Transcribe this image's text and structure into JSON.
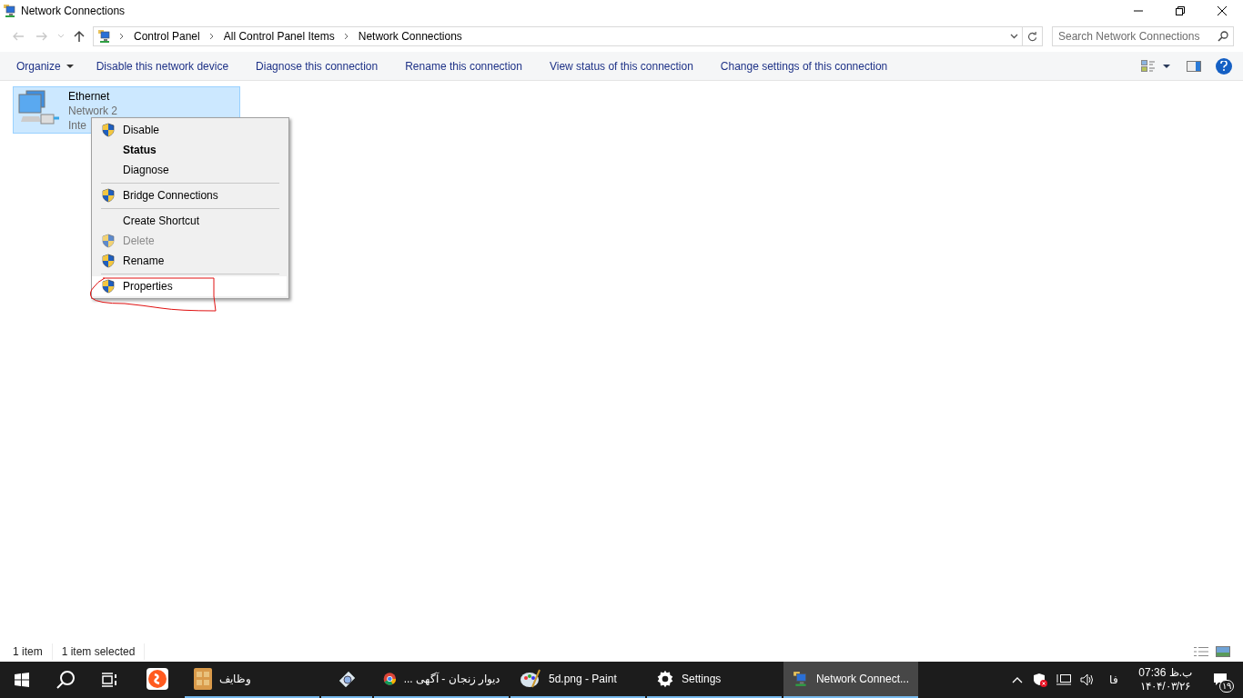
{
  "window": {
    "title": "Network Connections"
  },
  "address": {
    "breadcrumb": [
      "Control Panel",
      "All Control Panel Items",
      "Network Connections"
    ]
  },
  "search": {
    "placeholder": "Search Network Connections"
  },
  "toolbar": {
    "organize": "Organize",
    "commands": [
      "Disable this network device",
      "Diagnose this connection",
      "Rename this connection",
      "View status of this connection",
      "Change settings of this connection"
    ]
  },
  "items": [
    {
      "name": "Ethernet",
      "network": "Network 2",
      "status": "Inte",
      "selected": true
    }
  ],
  "context_menu": {
    "groups": [
      [
        {
          "label": "Disable",
          "shield": true,
          "bold": false,
          "disabled": false,
          "highlighted": false
        },
        {
          "label": "Status",
          "shield": false,
          "bold": true,
          "disabled": false,
          "highlighted": false
        },
        {
          "label": "Diagnose",
          "shield": false,
          "bold": false,
          "disabled": false,
          "highlighted": false
        }
      ],
      [
        {
          "label": "Bridge Connections",
          "shield": true,
          "bold": false,
          "disabled": false,
          "highlighted": false
        }
      ],
      [
        {
          "label": "Create Shortcut",
          "shield": false,
          "bold": false,
          "disabled": false,
          "highlighted": false
        },
        {
          "label": "Delete",
          "shield": true,
          "bold": false,
          "disabled": true,
          "highlighted": false
        },
        {
          "label": "Rename",
          "shield": true,
          "bold": false,
          "disabled": false,
          "highlighted": false
        }
      ],
      [
        {
          "label": "Properties",
          "shield": true,
          "bold": false,
          "disabled": false,
          "highlighted": true
        }
      ]
    ]
  },
  "status_bar": [
    "1 item",
    "1 item selected"
  ],
  "taskbar": {
    "apps": [
      {
        "kind": "orange",
        "running": false,
        "active": false
      },
      {
        "kind": "todo",
        "label": "وظايف",
        "running": true,
        "active": false
      },
      {
        "kind": "snip",
        "running": true,
        "active": false
      },
      {
        "kind": "chrome",
        "label": "... دیوار زنجان - آگهی",
        "running": true,
        "active": false
      },
      {
        "kind": "paint",
        "label": "5d.png - Paint",
        "running": true,
        "active": false
      },
      {
        "kind": "settings",
        "label": "Settings",
        "running": true,
        "active": false
      },
      {
        "kind": "network",
        "label": "Network Connect...",
        "running": true,
        "active": true
      }
    ],
    "language": "فا",
    "time": "07:36 ب.ظ",
    "date": "۱۴۰۴/۰۳/۲۶",
    "notifications": "۱۹"
  }
}
